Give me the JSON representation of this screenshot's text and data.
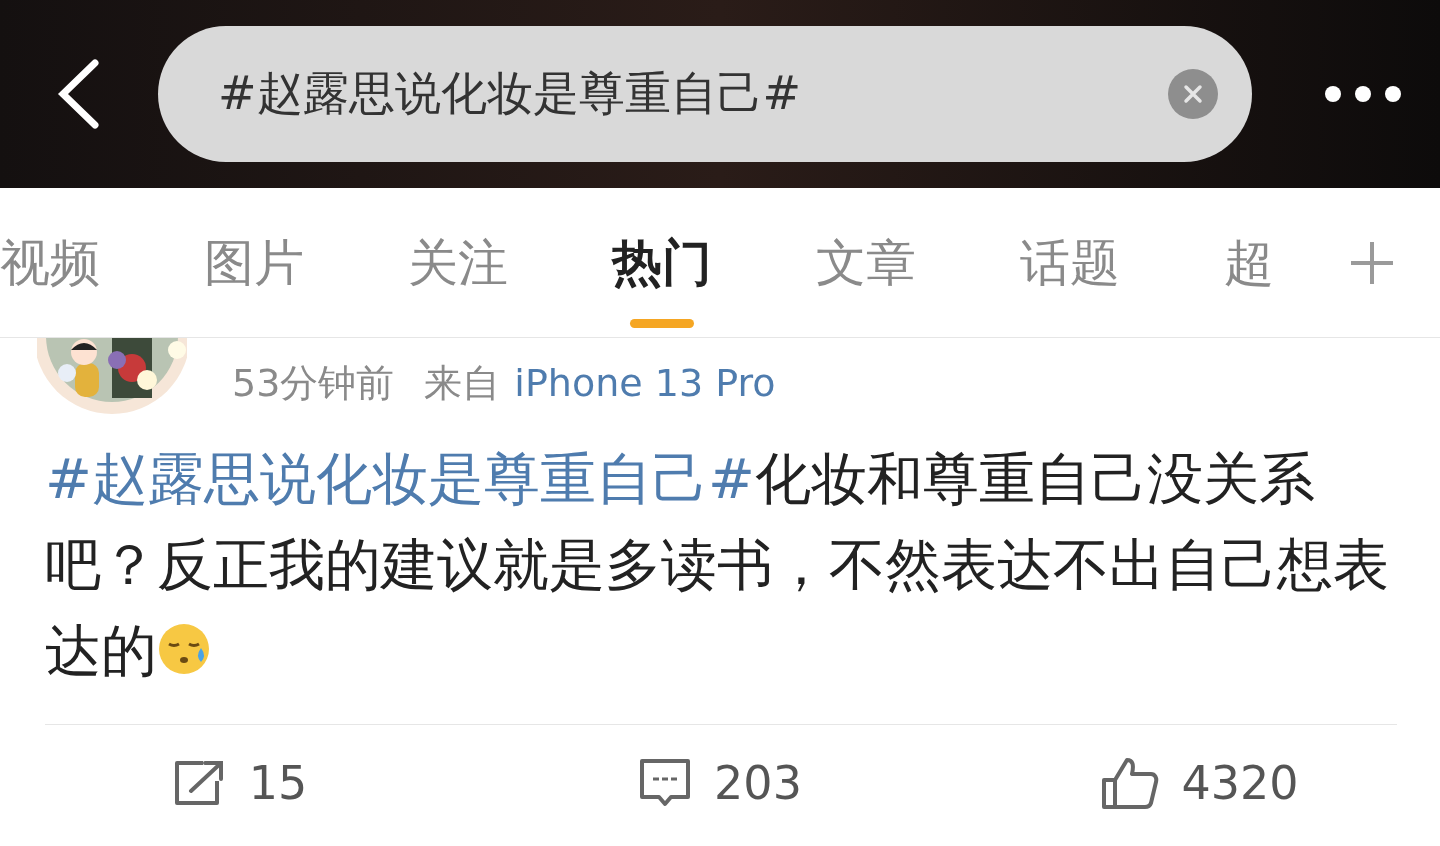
{
  "header": {
    "search": {
      "value": "#赵露思说化妆是尊重自己#"
    }
  },
  "tabs": [
    {
      "label": "视频",
      "selected": false
    },
    {
      "label": "图片",
      "selected": false
    },
    {
      "label": "关注",
      "selected": false
    },
    {
      "label": "热门",
      "selected": true
    },
    {
      "label": "文章",
      "selected": false
    },
    {
      "label": "话题",
      "selected": false
    },
    {
      "label": "超",
      "selected": false
    }
  ],
  "post": {
    "time": "53分钟前",
    "source_prefix": "来自",
    "source": "iPhone 13 Pro",
    "hashtag": "#赵露思说化妆是尊重自己#",
    "text": "化妆和尊重自己没关系吧？反正我的建议就是多读书，不然表达不出自己想表达的"
  },
  "actions": [
    {
      "kind": "repost",
      "count": "15"
    },
    {
      "kind": "comment",
      "count": "203"
    },
    {
      "kind": "like",
      "count": "4320"
    }
  ]
}
